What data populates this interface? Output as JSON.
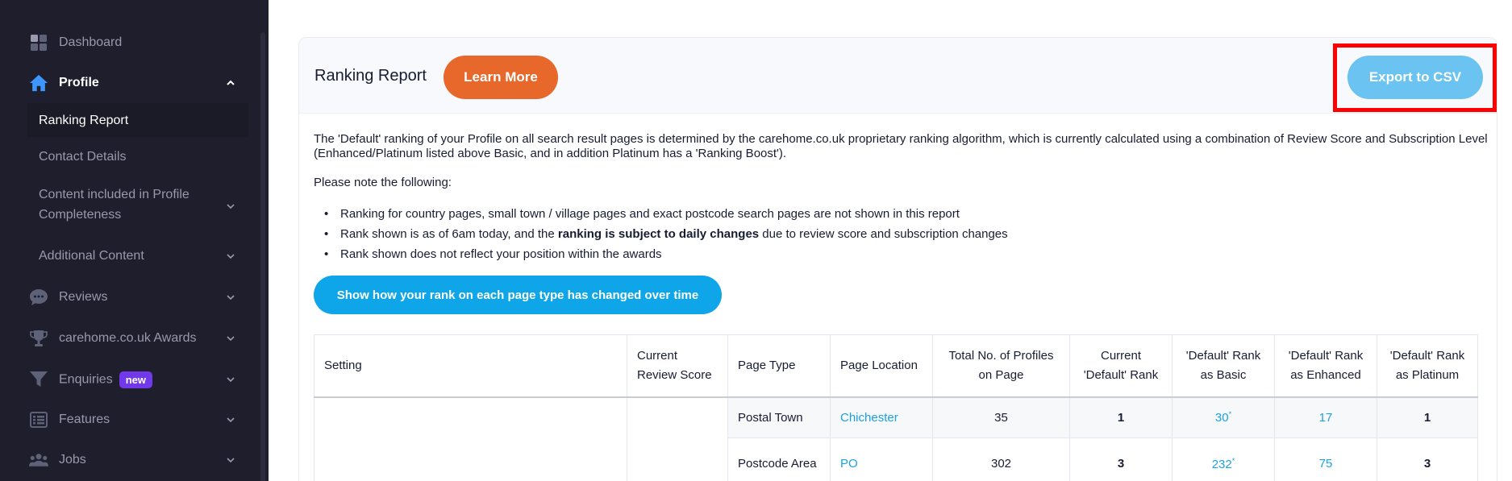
{
  "sidebar": {
    "items": [
      {
        "label": "Dashboard",
        "icon": "dashboard-icon"
      },
      {
        "label": "Profile",
        "icon": "home-icon"
      },
      {
        "label": "Reviews",
        "icon": "chat-bubble-icon"
      },
      {
        "label": "carehome.co.uk Awards",
        "icon": "trophy-icon"
      },
      {
        "label": "Enquiries",
        "icon": "funnel-icon",
        "badge": "new"
      },
      {
        "label": "Features",
        "icon": "list-icon"
      },
      {
        "label": "Jobs",
        "icon": "people-icon"
      }
    ],
    "profile_sub": [
      {
        "label": "Ranking Report"
      },
      {
        "label": "Contact Details"
      },
      {
        "label": "Content included in Profile Completeness"
      },
      {
        "label": "Additional Content"
      }
    ]
  },
  "card": {
    "title": "Ranking Report",
    "learn_more": "Learn More",
    "export_csv": "Export to CSV",
    "intro": "The 'Default' ranking of your Profile on all search result pages is determined by the carehome.co.uk proprietary ranking algorithm, which is currently calculated using a combination of Review Score and Subscription Level (Enhanced/Platinum listed above Basic, and in addition Platinum has a 'Ranking Boost').",
    "note": "Please note the following:",
    "bullets": {
      "b1": "Ranking for country pages, small town / village pages and exact postcode search pages are not shown in this report",
      "b2_pre": "Rank shown is as of 6am today, and the ",
      "b2_bold": "ranking is subject to daily changes",
      "b2_post": " due to review score and subscription changes",
      "b3": "Rank shown does not reflect your position within the awards"
    },
    "change_btn": "Show how your rank on each page type has changed over time"
  },
  "table": {
    "headers": [
      "Setting",
      "Current Review Score",
      "Page Type",
      "Page Location",
      "Total No. of Profiles on Page",
      "Current 'Default' Rank",
      "'Default' Rank as Basic",
      "'Default' Rank as Enhanced",
      "'Default' Rank as Platinum"
    ],
    "rows": [
      {
        "page_type": "Postal Town",
        "location": "Chichester",
        "total": "35",
        "current": "1",
        "basic": "30",
        "basic_mark": "*",
        "enhanced": "17",
        "platinum": "1"
      },
      {
        "page_type": "Postcode Area",
        "location": "PO",
        "total": "302",
        "current": "3",
        "basic": "232",
        "basic_mark": "*",
        "enhanced": "75",
        "platinum": "3"
      }
    ]
  },
  "colors": {
    "sidebar_bg": "#1e1e2d",
    "learn_more": "#e8672b",
    "export": "#6ac3f0",
    "primary": "#0ea5e9",
    "highlight": "#ff0000",
    "link": "#1aa1e6"
  }
}
